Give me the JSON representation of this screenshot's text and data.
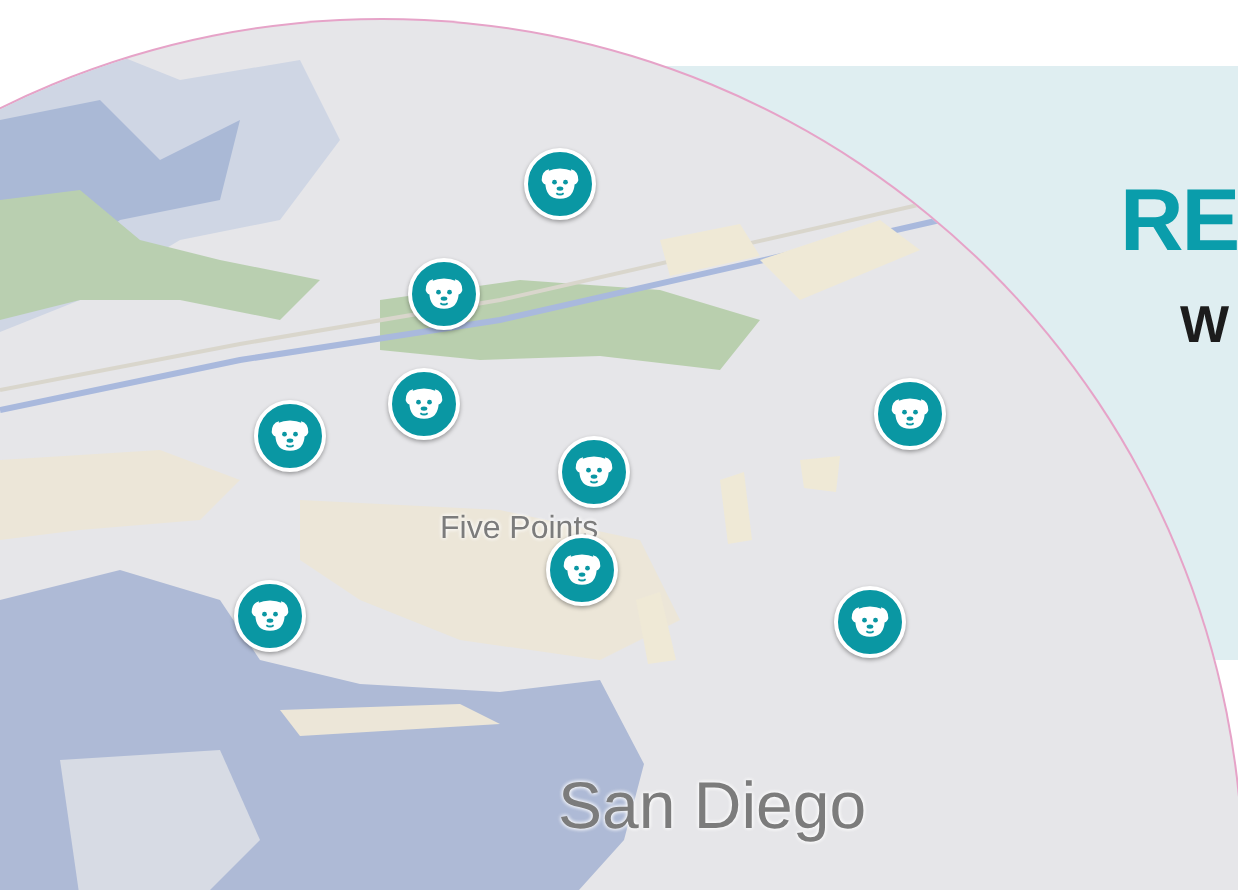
{
  "panel": {
    "heading": "RE",
    "subheading": "W"
  },
  "map": {
    "labels": [
      {
        "text": "Five Points",
        "kind": "neighborhood"
      },
      {
        "text": "San Diego",
        "kind": "city"
      }
    ]
  }
}
